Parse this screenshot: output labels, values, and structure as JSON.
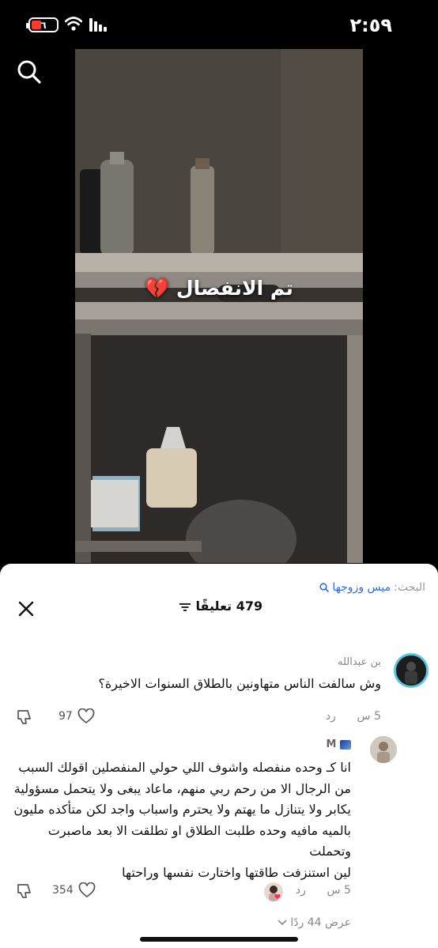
{
  "status_bar": {
    "time": "٢:٥٩",
    "battery": "٦"
  },
  "video": {
    "caption": "تم الانفصال 💔"
  },
  "comments_panel": {
    "search_label": "البحث:",
    "search_term": "ميس وزوجها",
    "count_label": "479 تعليقًا",
    "comments": [
      {
        "username": "بن عبدالله",
        "text": "وش سالفت الناس متهاونين بالطلاق السنوات الاخيرة؟",
        "time": "5 س",
        "reply": "رد",
        "likes": "97"
      },
      {
        "username": "M",
        "text_lines": [
          "انا كـ وحده منفصله واشوف اللي حولي المنفصلين اقولك السبب",
          "من الرجال الا من رحم ربي منهم، ماعاد يبغى ولا يتحمل مسؤولية",
          "يكابر ولا يتنازل ما يهتم ولا يحترم واسباب واجد لكن متأكده مليون",
          "بالميه مافيه وحده طلبت الطلاق او تطلقت الا بعد ماصبرت وتحملت",
          "لين استنزفت طاقتها واختارت نفسها وراحتها"
        ],
        "time": "5 س",
        "reply": "رد",
        "likes": "354",
        "view_replies": "عرض 44 ردًا"
      }
    ]
  },
  "colors": {
    "accent_link": "#2d6cdf",
    "avatar_ring": "#57c7e0",
    "battery_low": "#ff3b30"
  }
}
